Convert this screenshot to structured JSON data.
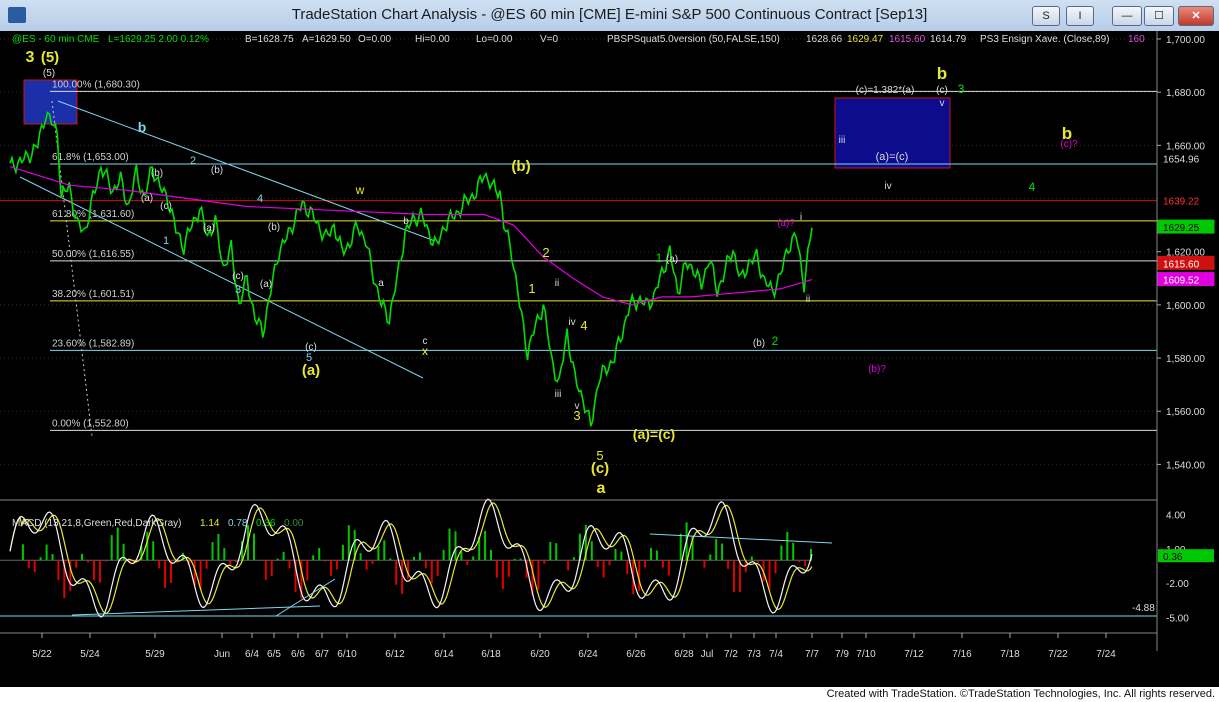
{
  "window": {
    "title": "TradeStation Chart Analysis - @ES 60 min [CME] E-mini S&P 500 Continuous Contract [Sep13]",
    "buttons": {
      "s": "S",
      "i": "I",
      "min": "—",
      "max": "☐",
      "close": "✕"
    }
  },
  "status_bar": {
    "symbol": "@ES - 60 min  CME",
    "last": "L=1629.25  2.00  0.12%",
    "bid": "B=1628.75",
    "ask": "A=1629.50",
    "open": "O=0.00",
    "hi": "Hi=0.00",
    "lo": "Lo=0.00",
    "vol": "V=0",
    "indicator": "PBSPSquat5.0version (50,FALSE,150)",
    "ind_values": [
      "1628.66",
      "1629.47",
      "1615.60",
      "1614.79"
    ],
    "ensign": "PS3 Ensign Xave. (Close,89)",
    "ensign_value": "160"
  },
  "footer": "Created with TradeStation. ©TradeStation Technologies, Inc. All rights reserved.",
  "chart_data": [
    {
      "type": "line",
      "panel": "price",
      "y_axis": {
        "ticks": [
          1540,
          1560,
          1580,
          1600,
          1620,
          1640,
          1660,
          1680,
          1700
        ],
        "tick_labels": [
          "1,540.00",
          "1,560.00",
          "1,580.00",
          "1,600.00",
          "1,620.00",
          "1,640.00",
          "1,660.00",
          "1,680.00",
          "1,700.00"
        ],
        "ylim": [
          1530,
          1703
        ]
      },
      "x_axis": {
        "tick_labels": [
          "5/22",
          "5/24",
          "5/29",
          "Jun",
          "6/4",
          "6/5",
          "6/6",
          "6/7",
          "6/10",
          "6/12",
          "6/14",
          "6/18",
          "6/20",
          "6/24",
          "6/26",
          "6/28",
          "Jul",
          "7/2",
          "7/3",
          "7/4",
          "7/7",
          "7/9",
          "7/10",
          "7/12",
          "7/16",
          "7/18",
          "7/22",
          "7/24"
        ]
      },
      "series": [
        {
          "color": "#00e000",
          "keypoints": [
            [
              0,
              1652
            ],
            [
              8,
              1655
            ],
            [
              14,
              1660
            ],
            [
              18,
              1672
            ],
            [
              24,
              1665
            ],
            [
              26,
              1640
            ],
            [
              30,
              1645
            ],
            [
              34,
              1630
            ],
            [
              38,
              1628
            ],
            [
              42,
              1640
            ],
            [
              46,
              1652
            ],
            [
              52,
              1643
            ],
            [
              56,
              1647
            ],
            [
              60,
              1637
            ],
            [
              64,
              1650
            ],
            [
              68,
              1640
            ],
            [
              72,
              1652
            ],
            [
              76,
              1644
            ],
            [
              80,
              1640
            ],
            [
              84,
              1628
            ],
            [
              88,
              1622
            ],
            [
              92,
              1630
            ],
            [
              96,
              1636
            ],
            [
              100,
              1626
            ],
            [
              104,
              1631
            ],
            [
              108,
              1614
            ],
            [
              112,
              1621
            ],
            [
              116,
              1600
            ],
            [
              120,
              1610
            ],
            [
              124,
              1595
            ],
            [
              128,
              1590
            ],
            [
              132,
              1605
            ],
            [
              136,
              1620
            ],
            [
              140,
              1625
            ],
            [
              144,
              1632
            ],
            [
              148,
              1638
            ],
            [
              152,
              1635
            ],
            [
              156,
              1630
            ],
            [
              160,
              1625
            ],
            [
              164,
              1630
            ],
            [
              168,
              1620
            ],
            [
              172,
              1623
            ],
            [
              176,
              1630
            ],
            [
              180,
              1624
            ],
            [
              184,
              1611
            ],
            [
              188,
              1600
            ],
            [
              192,
              1595
            ],
            [
              196,
              1610
            ],
            [
              200,
              1627
            ],
            [
              204,
              1632
            ],
            [
              208,
              1634
            ],
            [
              212,
              1627
            ],
            [
              216,
              1622
            ],
            [
              220,
              1630
            ],
            [
              224,
              1633
            ],
            [
              228,
              1636
            ],
            [
              232,
              1640
            ],
            [
              236,
              1642
            ],
            [
              240,
              1650
            ],
            [
              244,
              1644
            ],
            [
              248,
              1643
            ],
            [
              250,
              1630
            ],
            [
              254,
              1620
            ],
            [
              258,
              1600
            ],
            [
              262,
              1582
            ],
            [
              266,
              1592
            ],
            [
              270,
              1600
            ],
            [
              274,
              1580
            ],
            [
              278,
              1570
            ],
            [
              282,
              1590
            ],
            [
              286,
              1572
            ],
            [
              290,
              1565
            ],
            [
              294,
              1554
            ],
            [
              298,
              1572
            ],
            [
              302,
              1576
            ],
            [
              306,
              1580
            ],
            [
              310,
              1590
            ],
            [
              314,
              1600
            ],
            [
              318,
              1602
            ],
            [
              322,
              1600
            ],
            [
              326,
              1603
            ],
            [
              330,
              1612
            ],
            [
              334,
              1620
            ],
            [
              338,
              1605
            ],
            [
              342,
              1615
            ],
            [
              346,
              1614
            ],
            [
              350,
              1607
            ],
            [
              354,
              1618
            ],
            [
              358,
              1605
            ],
            [
              362,
              1613
            ],
            [
              366,
              1621
            ],
            [
              370,
              1609
            ],
            [
              374,
              1616
            ],
            [
              378,
              1618
            ],
            [
              382,
              1609
            ],
            [
              386,
              1605
            ],
            [
              390,
              1611
            ],
            [
              394,
              1622
            ],
            [
              398,
              1626
            ],
            [
              402,
              1608
            ],
            [
              406,
              1629
            ]
          ]
        },
        {
          "color": "#e000e0",
          "keypoints": [
            [
              0,
              1652
            ],
            [
              30,
              1645
            ],
            [
              60,
              1643
            ],
            [
              90,
              1640
            ],
            [
              120,
              1637
            ],
            [
              150,
              1636
            ],
            [
              180,
              1635
            ],
            [
              210,
              1634
            ],
            [
              240,
              1634
            ],
            [
              255,
              1630
            ],
            [
              270,
              1618
            ],
            [
              285,
              1610
            ],
            [
              300,
              1603
            ],
            [
              315,
              1600
            ],
            [
              330,
              1603
            ],
            [
              345,
              1603
            ],
            [
              360,
              1604
            ],
            [
              375,
              1605
            ],
            [
              390,
              1606
            ],
            [
              406,
              1609.5
            ]
          ]
        }
      ],
      "fib_levels": [
        {
          "label": "100.00% (1,680.30)",
          "value": 1680.3
        },
        {
          "label": "61.8% (1,653.00)",
          "value": 1653.0
        },
        {
          "label": "61.80% (1,631.60)",
          "value": 1631.6
        },
        {
          "label": "50.00% (1,616.55)",
          "value": 1616.55
        },
        {
          "label": "38.20% (1,601.51)",
          "value": 1601.51
        },
        {
          "label": "23.60% (1,582.89)",
          "value": 1582.89
        },
        {
          "label": "0.00% (1,552.80)",
          "value": 1552.8
        }
      ],
      "price_boxes": [
        "1654.96",
        "1639.22",
        "1629.25",
        "1615.60",
        "1609.52"
      ],
      "annotations": [
        "3",
        "(5)",
        "(5)",
        "b",
        "2",
        "(b)",
        "(b)",
        "(a)",
        "(c)",
        "1",
        "(a)",
        "(c)",
        "3",
        "(a)",
        "4",
        "(b)",
        "(c)",
        "5",
        "(a)",
        "w",
        "b",
        "a",
        "c",
        "x",
        "(b)",
        "2",
        "1",
        "ii",
        "iv",
        "4",
        "iii",
        "v",
        "3",
        "5",
        "(c)",
        "a",
        "(a)=(c)",
        "1",
        "(a)",
        "(b)",
        "2",
        "(a)?",
        "i",
        "ii",
        "(c)=1.382*(a)",
        "(c)",
        "v",
        "b",
        "3",
        "iii",
        "(a)=(c)",
        "iv",
        "4",
        "b",
        "(c)?",
        "(b)?"
      ]
    },
    {
      "type": "line",
      "panel": "macd",
      "title": "MACD (13,21,8,Green,Red,DarkGray)",
      "values_text": [
        "1.14",
        "0.78",
        "0.36",
        "0.00"
      ],
      "y_axis": {
        "ticks": [
          4,
          1,
          -2,
          -5
        ],
        "tick_labels": [
          "4.00",
          "1.00",
          "-2.00",
          "-5.00"
        ],
        "ylim": [
          -6.2,
          5.2
        ]
      },
      "extra_labels": [
        "0.36",
        "-4.88"
      ]
    }
  ]
}
